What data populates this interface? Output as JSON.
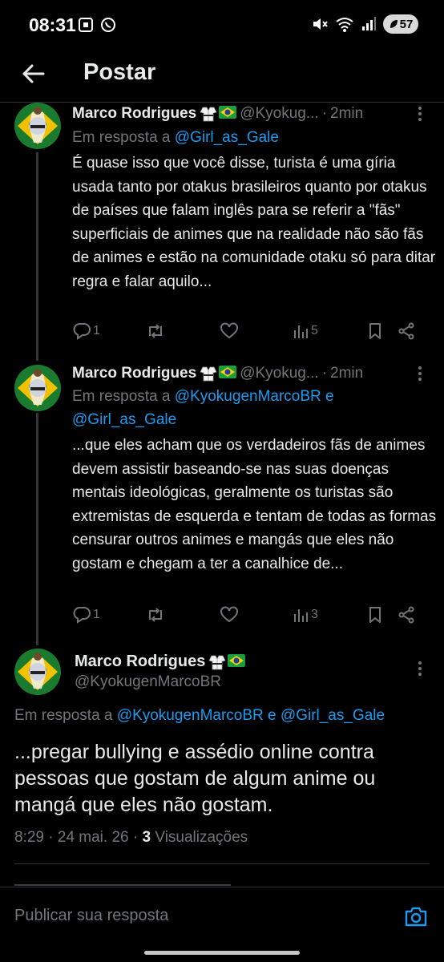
{
  "status_bar": {
    "time": "08:31",
    "battery": "57"
  },
  "header": {
    "title": "Postar"
  },
  "thread": [
    {
      "name": "Marco Rodrigues",
      "handle": "@Kyokug...",
      "time": "2min",
      "reply_prefix": "Em resposta a",
      "reply_mentions": [
        "@Girl_as_Gale"
      ],
      "reply_join": "",
      "text": "É quase isso que você disse, turista é uma gíria usada tanto por otakus brasileiros quanto por otakus de países que falam inglês para se referir a \"fãs\" superficiais de animes que na realidade não são fãs de animes e estão na comunidade otaku só para ditar regra e falar aquilo...",
      "replies": "1",
      "views": "5"
    },
    {
      "name": "Marco Rodrigues",
      "handle": "@Kyokug...",
      "time": "2min",
      "reply_prefix": "Em resposta a",
      "reply_mentions": [
        "@KyokugenMarcoBR",
        "@Girl_as_Gale"
      ],
      "reply_join": "e",
      "text": "...que eles acham que os verdadeiros fãs de animes devem assistir baseando-se nas suas doenças mentais ideológicas, geralmente os turistas são extremistas de esquerda e tentam de todas as formas censurar outros animes e mangás que eles não gostam e chegam a ter a canalhice de...",
      "replies": "1",
      "views": "3"
    }
  ],
  "main_tweet": {
    "name": "Marco Rodrigues",
    "handle": "@KyokugenMarcoBR",
    "reply_prefix": "Em resposta a",
    "reply_mention_1": "@KyokugenMarcoBR",
    "reply_join": "e",
    "reply_mention_2": "@Girl_as_Gale",
    "text": "...pregar bullying e assédio online contra pessoas que gostam de algum anime ou mangá que eles não gostam.",
    "time": "8:29",
    "date": "24 mai. 26",
    "views_count": "3",
    "views_label": "Visualizações"
  },
  "composer": {
    "placeholder": "Publicar sua resposta"
  },
  "colors": {
    "accent": "#1d9bf0",
    "muted": "#71767b",
    "text": "#e7e9ea",
    "background": "#000000"
  }
}
